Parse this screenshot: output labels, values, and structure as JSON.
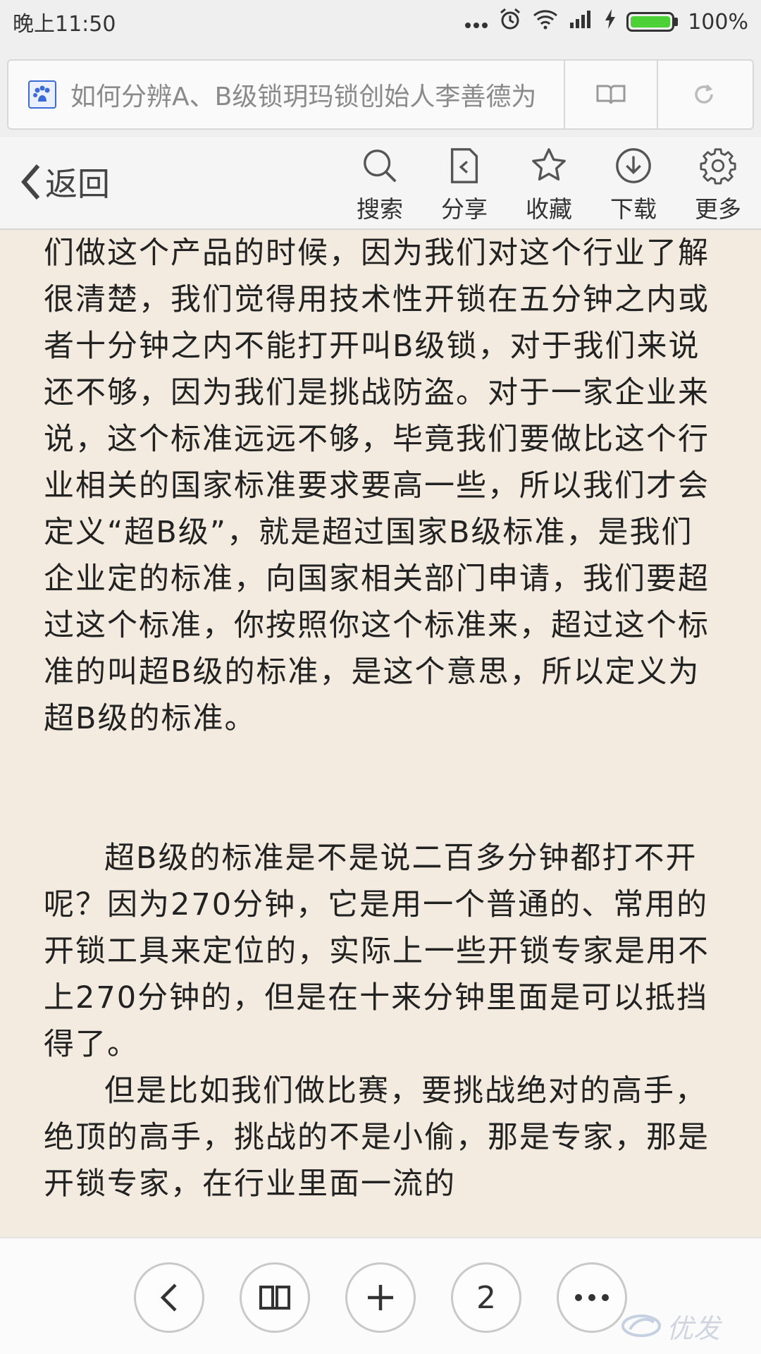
{
  "status_bar": {
    "time": "晚上11:50",
    "battery": "100%",
    "battery_level": 1.0
  },
  "url_bar": {
    "title": "如何分辨A、B级锁玥玛锁创始人李善德为"
  },
  "toolbar": {
    "back_label": "返回",
    "items": [
      {
        "label": "搜索",
        "icon": "search-icon"
      },
      {
        "label": "分享",
        "icon": "share-icon"
      },
      {
        "label": "收藏",
        "icon": "star-icon"
      },
      {
        "label": "下载",
        "icon": "download-icon"
      },
      {
        "label": "更多",
        "icon": "gear-icon"
      }
    ]
  },
  "article": {
    "paragraph1": "们做这个产品的时候，因为我们对这个行业了解很清楚，我们觉得用技术性开锁在五分钟之内或者十分钟之内不能打开叫B级锁，对于我们来说还不够，因为我们是挑战防盗。对于一家企业来说，这个标准远远不够，毕竟我们要做比这个行业相关的国家标准要求要高一些，所以我们才会定义“超B级”，就是超过国家B级标准，是我们企业定的标准，向国家相关部门申请，我们要超过这个标准，你按照你这个标准来，超过这个标准的叫超B级的标准，是这个意思，所以定义为超B级的标准。",
    "paragraph2": "超B级的标准是不是说二百多分钟都打不开呢？因为270分钟，它是用一个普通的、常用的开锁工具来定位的，实际上一些开锁专家是用不上270分钟的，但是在十来分钟里面是可以抵挡得了。",
    "paragraph3": "但是比如我们做比赛，要挑战绝对的高手，绝顶的高手，挑战的不是小偷，那是专家，那是开锁专家，在行业里面一流的"
  },
  "bottom_bar": {
    "tab_count": "2",
    "watermark_text": "优发"
  },
  "colors": {
    "background": "#f3ebdf",
    "battery_green": "#4cd137",
    "favicon_blue": "#3c6bd6"
  }
}
